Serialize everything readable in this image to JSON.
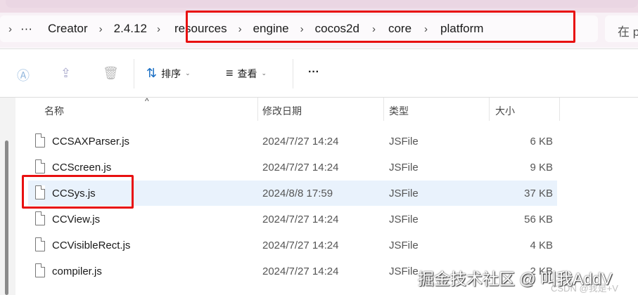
{
  "breadcrumb": {
    "overflow": "···",
    "items": [
      "Creator",
      "2.4.12",
      "resources",
      "engine",
      "cocos2d",
      "core",
      "platform"
    ]
  },
  "search": {
    "placeholder": "在 p"
  },
  "toolbar": {
    "sort": "排序",
    "view": "查看",
    "more": "···"
  },
  "columns": {
    "name": "名称",
    "date": "修改日期",
    "type": "类型",
    "size": "大小"
  },
  "files": [
    {
      "name": "CCSAXParser.js",
      "date": "2024/7/27 14:24",
      "type": "JSFile",
      "size": "6 KB"
    },
    {
      "name": "CCScreen.js",
      "date": "2024/7/27 14:24",
      "type": "JSFile",
      "size": "9 KB"
    },
    {
      "name": "CCSys.js",
      "date": "2024/8/8 17:59",
      "type": "JSFile",
      "size": "37 KB",
      "selected": true
    },
    {
      "name": "CCView.js",
      "date": "2024/7/27 14:24",
      "type": "JSFile",
      "size": "56 KB"
    },
    {
      "name": "CCVisibleRect.js",
      "date": "2024/7/27 14:24",
      "type": "JSFile",
      "size": "4 KB"
    },
    {
      "name": "compiler.js",
      "date": "2024/7/27 14:24",
      "type": "JSFile",
      "size": "2 KB"
    }
  ],
  "watermark": {
    "main": "掘金技术社区 @ 叫我AddV",
    "csdn": "CSDN @我是+V"
  }
}
